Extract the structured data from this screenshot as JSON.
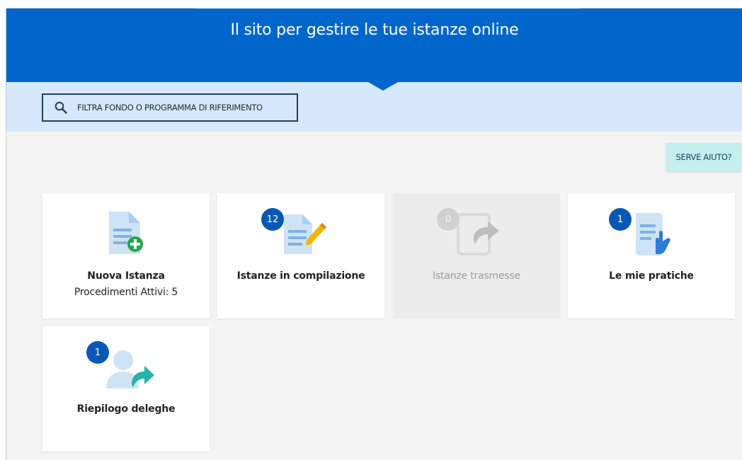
{
  "hero": {
    "title": "Il sito per gestire le tue istanze online"
  },
  "filter": {
    "label": "FILTRA FONDO O PROGRAMMA DI RIFERIMENTO"
  },
  "help": {
    "label": "SERVE AIUTO?"
  },
  "colors": {
    "primary": "#0066cc",
    "band": "#d6e8fb",
    "help_bg": "#c3efee",
    "badge": "#0a58b6"
  },
  "cards": [
    {
      "title": "Nuova Istanza",
      "subtitle": "Procedimenti Attivi: 5",
      "icon": "document-add-icon",
      "badge": ""
    },
    {
      "title": "Istanze in compilazione",
      "icon": "document-edit-icon",
      "badge": "12"
    },
    {
      "title": "Istanze trasmesse",
      "icon": "document-send-icon",
      "badge": "0",
      "disabled": true
    },
    {
      "title": "Le mie pratiche",
      "icon": "document-hand-icon",
      "badge": "1"
    },
    {
      "title": "Riepilogo deleghe",
      "icon": "user-delegate-icon",
      "badge": "1"
    }
  ]
}
